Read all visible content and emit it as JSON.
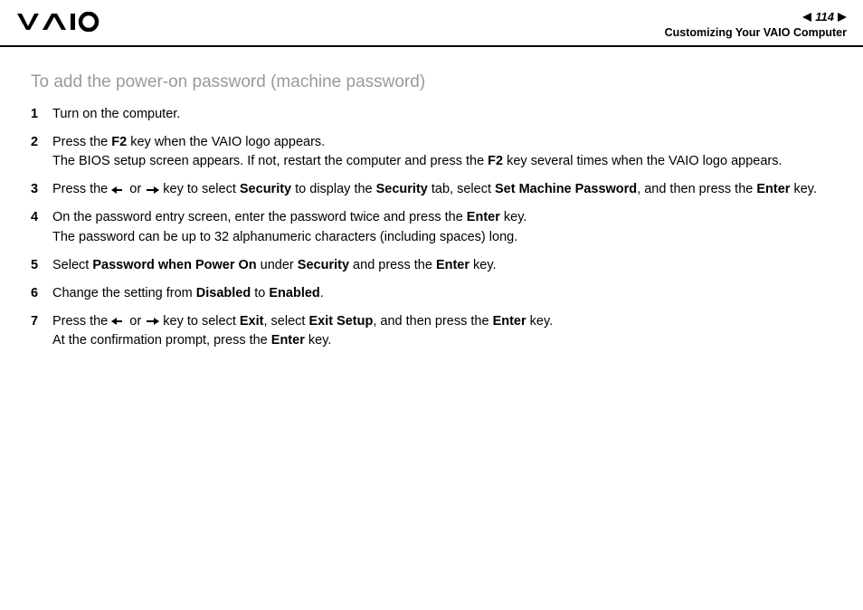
{
  "header": {
    "page_number": "114",
    "breadcrumb": "Customizing Your VAIO Computer"
  },
  "section_title": "To add the power-on password (machine password)",
  "steps": [
    {
      "num": "1",
      "lines": [
        [
          {
            "t": "Turn on the computer."
          }
        ]
      ]
    },
    {
      "num": "2",
      "lines": [
        [
          {
            "t": "Press the "
          },
          {
            "t": "F2",
            "b": true
          },
          {
            "t": " key when the VAIO logo appears."
          }
        ],
        [
          {
            "t": "The BIOS setup screen appears. If not, restart the computer and press the "
          },
          {
            "t": "F2",
            "b": true
          },
          {
            "t": " key several times when the VAIO logo appears."
          }
        ]
      ]
    },
    {
      "num": "3",
      "lines": [
        [
          {
            "t": "Press the "
          },
          {
            "arrow": "left"
          },
          {
            "t": " or "
          },
          {
            "arrow": "right"
          },
          {
            "t": " key to select "
          },
          {
            "t": "Security",
            "b": true
          },
          {
            "t": " to display the "
          },
          {
            "t": "Security",
            "b": true
          },
          {
            "t": " tab, select "
          },
          {
            "t": "Set Machine Password",
            "b": true
          },
          {
            "t": ", and then press the "
          },
          {
            "t": "Enter",
            "b": true
          },
          {
            "t": " key."
          }
        ]
      ]
    },
    {
      "num": "4",
      "lines": [
        [
          {
            "t": "On the password entry screen, enter the password twice and press the "
          },
          {
            "t": "Enter",
            "b": true
          },
          {
            "t": " key."
          }
        ],
        [
          {
            "t": "The password can be up to 32 alphanumeric characters (including spaces) long."
          }
        ]
      ]
    },
    {
      "num": "5",
      "lines": [
        [
          {
            "t": "Select "
          },
          {
            "t": "Password when Power On",
            "b": true
          },
          {
            "t": " under "
          },
          {
            "t": "Security",
            "b": true
          },
          {
            "t": " and press the "
          },
          {
            "t": "Enter",
            "b": true
          },
          {
            "t": " key."
          }
        ]
      ]
    },
    {
      "num": "6",
      "lines": [
        [
          {
            "t": "Change the setting from "
          },
          {
            "t": "Disabled",
            "b": true
          },
          {
            "t": " to "
          },
          {
            "t": "Enabled",
            "b": true
          },
          {
            "t": "."
          }
        ]
      ]
    },
    {
      "num": "7",
      "lines": [
        [
          {
            "t": "Press the "
          },
          {
            "arrow": "left"
          },
          {
            "t": " or "
          },
          {
            "arrow": "right"
          },
          {
            "t": " key to select "
          },
          {
            "t": "Exit",
            "b": true
          },
          {
            "t": ", select "
          },
          {
            "t": "Exit Setup",
            "b": true
          },
          {
            "t": ", and then press the "
          },
          {
            "t": "Enter",
            "b": true
          },
          {
            "t": " key."
          }
        ],
        [
          {
            "t": "At the confirmation prompt, press the "
          },
          {
            "t": "Enter",
            "b": true
          },
          {
            "t": " key."
          }
        ]
      ]
    }
  ]
}
